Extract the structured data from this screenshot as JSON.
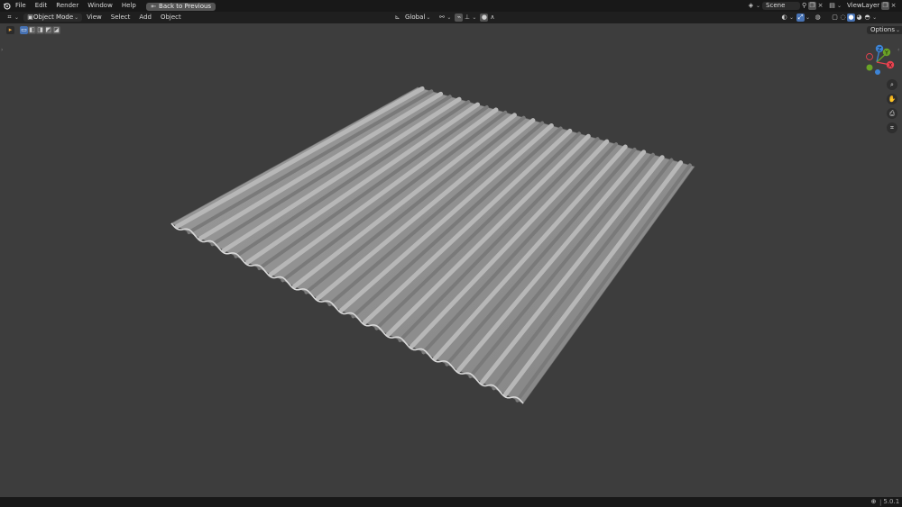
{
  "menu": {
    "items": [
      "File",
      "Edit",
      "Render",
      "Window",
      "Help"
    ],
    "back_button": "Back to Previous"
  },
  "scene": {
    "label": "Scene",
    "view_layer": "ViewLayer"
  },
  "header": {
    "mode": "Object Mode",
    "menus": [
      "View",
      "Select",
      "Add",
      "Object"
    ],
    "transform_orientation": "Global",
    "options_label": "Options"
  },
  "gizmo": {
    "z": "Z",
    "y": "Y",
    "x": "X"
  },
  "status": {
    "version": "5.0.1"
  },
  "icons": {
    "blender_logo": "blender-logo-icon",
    "editor_type": "3d-viewport-icon",
    "zoom": "magnifier-icon",
    "pan": "hand-icon",
    "camera": "camera-icon",
    "perspective": "grid-perspective-icon"
  },
  "colors": {
    "viewport_bg": "#3d3d3d",
    "header_bg": "#1f1f1f",
    "accent": "#4772b3",
    "axis_x": "#e8424f",
    "axis_y": "#6aa326",
    "axis_z": "#3d84d6"
  }
}
